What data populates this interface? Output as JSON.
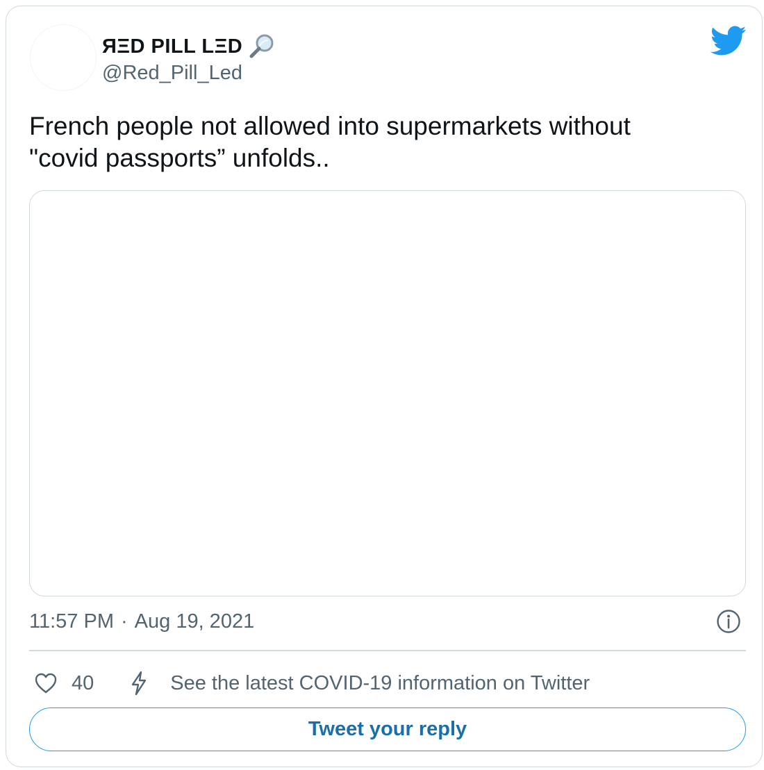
{
  "user": {
    "display_name": "ЯΞD PILL LΞD",
    "handle": "@Red_Pill_Led",
    "name_emoji_icon": "magnifier-icon"
  },
  "brand": {
    "logo_icon": "twitter-bird-icon",
    "accent_color": "#1d9bf0"
  },
  "tweet": {
    "text_lines": [
      "French people not allowed into supermarkets without",
      "\"covid passports” unfolds.."
    ],
    "time": "11:57 PM",
    "separator": "·",
    "date": "Aug 19, 2021"
  },
  "actions": {
    "like_icon": "heart-icon",
    "like_count": "40",
    "covid_icon": "lightning-bolt-icon",
    "covid_link_text": "See the latest COVID-19 information on Twitter",
    "info_icon": "info-icon"
  },
  "reply": {
    "button_label": "Tweet your reply"
  },
  "colors": {
    "text_primary": "#0f1419",
    "text_secondary": "#536471",
    "border": "#cfd9de",
    "reply_text": "#1a6fa8"
  }
}
